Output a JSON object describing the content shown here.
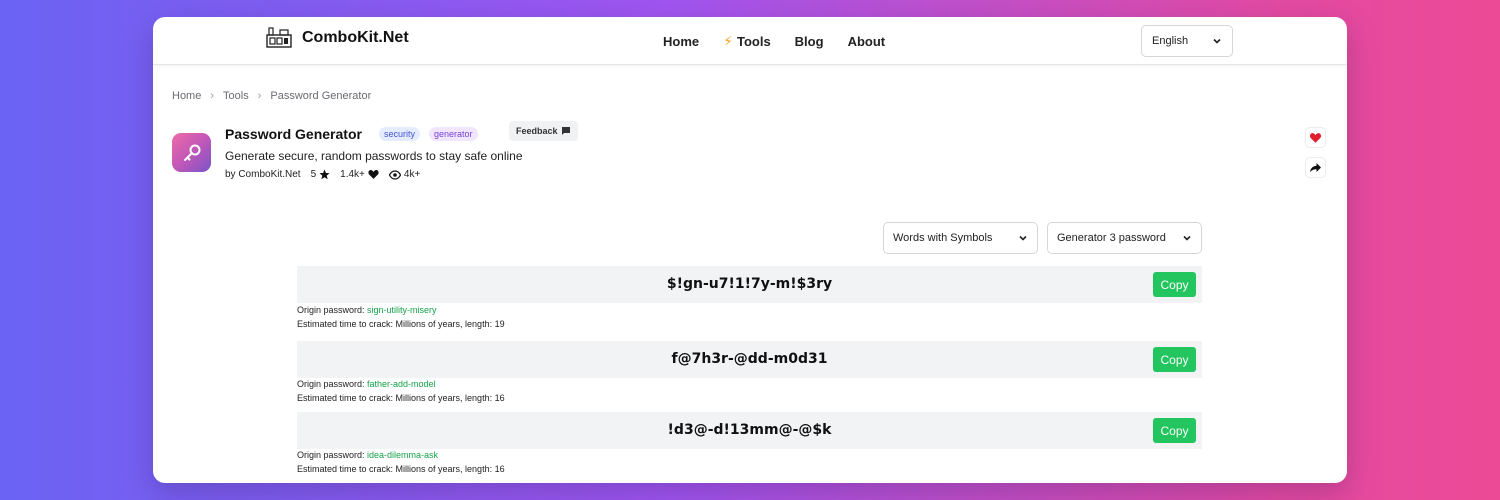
{
  "header": {
    "logo_text": "ComboKit.Net",
    "nav": [
      "Home",
      "Tools",
      "Blog",
      "About"
    ],
    "language": "English"
  },
  "breadcrumb": [
    "Home",
    "Tools",
    "Password Generator"
  ],
  "tool": {
    "title": "Password Generator",
    "tags": [
      "security",
      "generator"
    ],
    "feedback_label": "Feedback",
    "description": "Generate secure, random passwords to stay safe online",
    "author": "by ComboKit.Net",
    "rating": "5",
    "likes": "1.4k+",
    "views": "4k+"
  },
  "controls": {
    "mode": "Words with Symbols",
    "count": "Generator 3 password"
  },
  "labels": {
    "origin_prefix": "Origin password: ",
    "crack_prefix": "Estimated time to crack: Millions of years, length: ",
    "copy": "Copy"
  },
  "passwords": [
    {
      "value": "$!gn-u7!1!7y-m!$3ry",
      "origin": "sign-utility-misery",
      "length": "19"
    },
    {
      "value": "f@7h3r-@dd-m0d31",
      "origin": "father-add-model",
      "length": "16"
    },
    {
      "value": "!d3@-d!13mm@-@$k",
      "origin": "idea-dilemma-ask",
      "length": "16"
    }
  ],
  "colors": {
    "copy_button": "#22c55e",
    "origin_text": "#16a34a",
    "heart": "#e11d2e"
  },
  "icons": [
    "logo-icon",
    "bolt-icon",
    "chevron-down-icon",
    "chevron-right-icon",
    "key-icon",
    "message-icon",
    "star-icon",
    "heart-icon",
    "eye-icon",
    "share-icon"
  ]
}
